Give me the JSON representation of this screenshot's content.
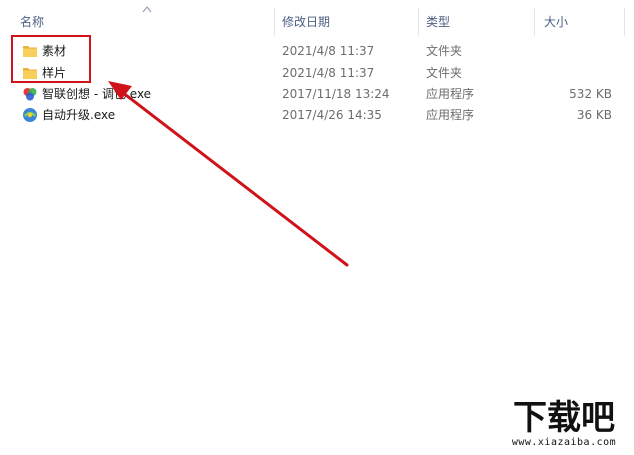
{
  "columns": {
    "name": "名称",
    "modified": "修改日期",
    "type": "类型",
    "size": "大小"
  },
  "files": [
    {
      "name": "素材",
      "modified": "2021/4/8 11:37",
      "type": "文件夹",
      "size": "",
      "icon": "folder-icon"
    },
    {
      "name": "样片",
      "modified": "2021/4/8 11:37",
      "type": "文件夹",
      "size": "",
      "icon": "folder-icon"
    },
    {
      "name": "智联创想 - 调色.exe",
      "modified": "2017/11/18 13:24",
      "type": "应用程序",
      "size": "532 KB",
      "icon": "color-app-icon"
    },
    {
      "name": "自动升级.exe",
      "modified": "2017/4/26 14:35",
      "type": "应用程序",
      "size": "36 KB",
      "icon": "updater-app-icon"
    }
  ],
  "watermark": {
    "logo": "下载吧",
    "url": "www.xiazaiba.com"
  },
  "colors": {
    "annotation_red": "#d0121b",
    "header_text": "#4d6082",
    "folder_yellow": "#f5c84c"
  }
}
